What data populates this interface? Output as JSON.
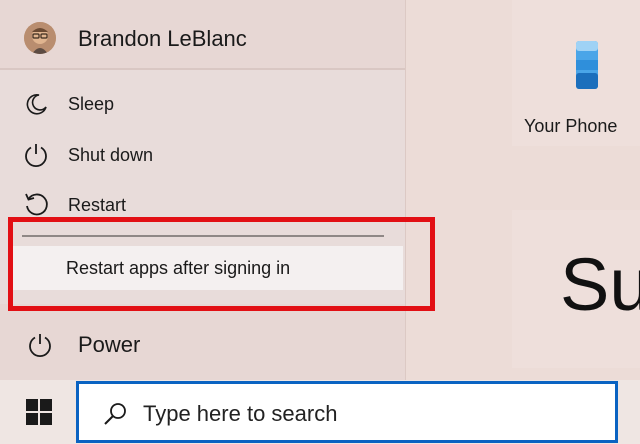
{
  "user": {
    "name": "Brandon LeBlanc",
    "avatar_icon": "user-avatar"
  },
  "power_menu": {
    "items": [
      {
        "label": "Sleep",
        "icon": "moon-icon"
      },
      {
        "label": "Shut down",
        "icon": "power-icon"
      },
      {
        "label": "Restart",
        "icon": "restart-icon"
      }
    ],
    "option_label": "Restart apps after signing in"
  },
  "power_button": {
    "label": "Power",
    "icon": "power-icon"
  },
  "tiles": {
    "phone": {
      "label": "Your Phone",
      "icon": "phone-icon"
    },
    "partial": {
      "text": "Sur"
    }
  },
  "taskbar": {
    "start_icon": "windows-logo-icon",
    "search_placeholder": "Type here to search",
    "search_icon": "search-icon"
  },
  "colors": {
    "highlight": "#e20f14",
    "search_border": "#0a63c2"
  }
}
